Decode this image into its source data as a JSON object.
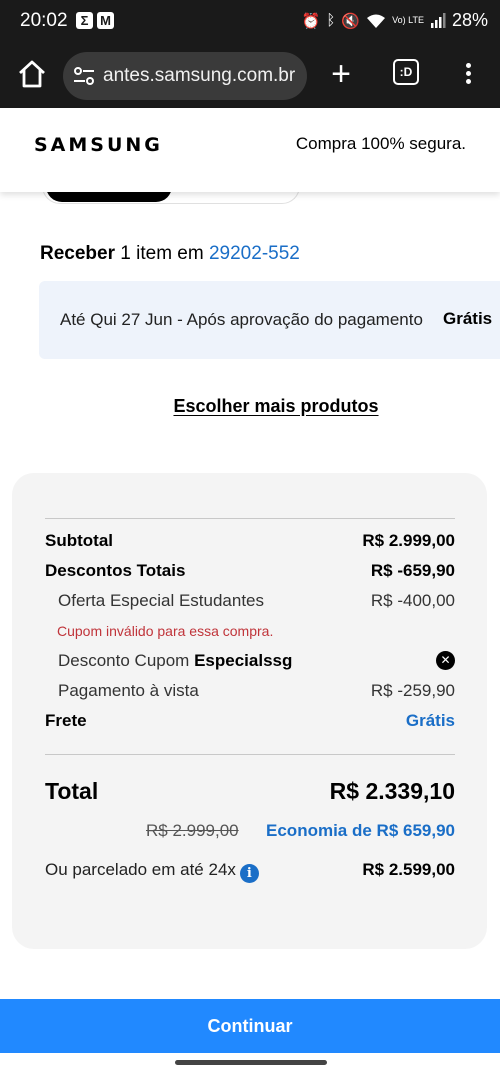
{
  "status_bar": {
    "time": "20:02",
    "app_icons": [
      "Σ",
      "M"
    ],
    "battery": "28%",
    "lte": "Vo) LTE"
  },
  "browser": {
    "url": "antes.samsung.com.br",
    "tabs_label": ":D"
  },
  "header": {
    "logo": "SAMSUNG",
    "secure_text": "Compra 100% segura."
  },
  "delivery": {
    "receive_label": "Receber",
    "items_text": " 1 item em ",
    "zip": "29202-552",
    "date_text": "Até Qui 27 Jun - Após aprovação do pagamento",
    "shipping_free": "Grátis"
  },
  "links": {
    "more_products": "Escolher mais produtos"
  },
  "summary": {
    "subtotal_label": "Subtotal",
    "subtotal_value": "R$ 2.999,00",
    "discounts_label": "Descontos Totais",
    "discounts_value": "R$ -659,90",
    "student_offer_label": "Oferta Especial Estudantes",
    "student_offer_value": "R$ -400,00",
    "coupon_error": "Cupom inválido para essa compra.",
    "coupon_label": "Desconto Cupom ",
    "coupon_code": "Especialssg",
    "cash_payment_label": "Pagamento à vista",
    "cash_payment_value": "R$ -259,90",
    "shipping_label": "Frete",
    "shipping_value": "Grátis",
    "total_label": "Total",
    "total_value": "R$ 2.339,10",
    "original_price": "R$ 2.999,00",
    "savings": "Economia de R$ 659,90",
    "installment_label": "Ou parcelado em até 24x",
    "installment_value": "R$ 2.599,00"
  },
  "actions": {
    "continue": "Continuar"
  },
  "colors": {
    "accent": "#2189ff",
    "link": "#1a6ec7",
    "error": "#c0343a"
  }
}
